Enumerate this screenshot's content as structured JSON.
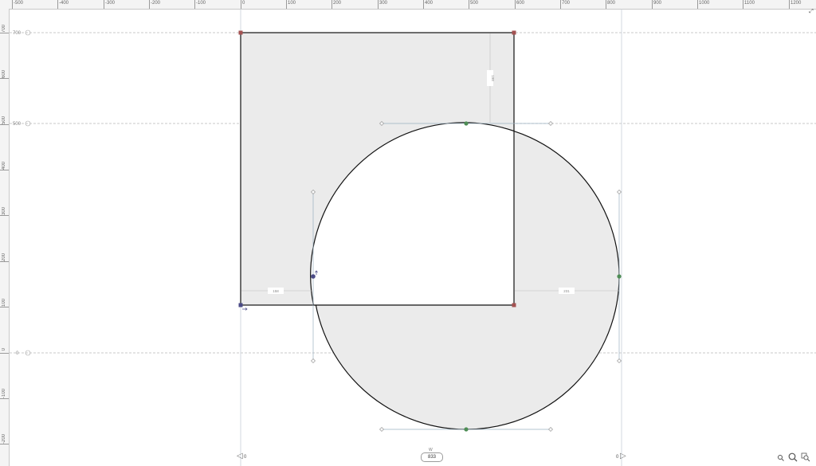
{
  "ruler_top": {
    "labels": [
      "-500",
      "-400",
      "-300",
      "-200",
      "-100",
      "0",
      "100",
      "200",
      "300",
      "400",
      "500",
      "600",
      "700",
      "800",
      "900",
      "1000",
      "1100",
      "1200"
    ]
  },
  "ruler_left": {
    "labels": [
      "700",
      "600",
      "500",
      "400",
      "300",
      "200",
      "100",
      "0",
      "-100",
      "-200"
    ]
  },
  "guides": {
    "h1": "700",
    "h2": "500",
    "h3": "0"
  },
  "dimensions": {
    "left_gap": "158",
    "right_gap": "231",
    "top_gap": "198"
  },
  "bottom_bar": {
    "left_value": "0",
    "width_label": "W",
    "width_value": "833",
    "right_value": "0"
  },
  "colors": {
    "shape_fill": "#ebebeb",
    "stroke": "#111111",
    "guide": "#b8b8b8",
    "handle_green": "#4e8d55",
    "handle_red": "#a45252",
    "handle_blue": "#4a4a86"
  }
}
